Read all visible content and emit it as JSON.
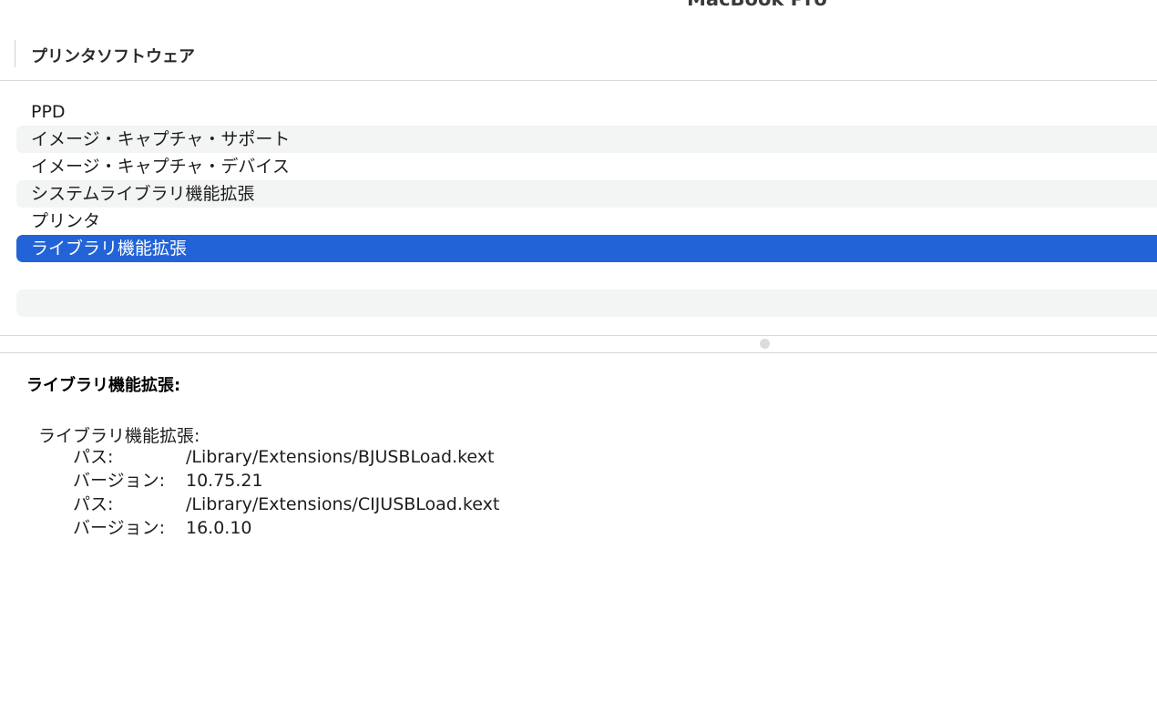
{
  "window": {
    "title": "MacBook Pro"
  },
  "column_header": {
    "title": "プリンタソフトウェア"
  },
  "list": {
    "items": [
      {
        "label": "PPD"
      },
      {
        "label": "イメージ・キャプチャ・サポート"
      },
      {
        "label": "イメージ・キャプチャ・デバイス"
      },
      {
        "label": "システムライブラリ機能拡張"
      },
      {
        "label": "プリンタ"
      },
      {
        "label": "ライブラリ機能拡張",
        "selected": true
      },
      {
        "label": ""
      },
      {
        "label": ""
      }
    ]
  },
  "detail": {
    "heading": "ライブラリ機能拡張:",
    "section_title": "ライブラリ機能拡張:",
    "entries": [
      {
        "key": "パス:",
        "value": "/Library/Extensions/BJUSBLoad.kext"
      },
      {
        "key": "バージョン:",
        "value": "10.75.21"
      },
      {
        "key": "パス:",
        "value": "/Library/Extensions/CIJUSBLoad.kext"
      },
      {
        "key": "バージョン:",
        "value": "16.0.10"
      }
    ]
  },
  "colors": {
    "selection": "#2264d8",
    "alt_row": "#f3f4f4"
  }
}
